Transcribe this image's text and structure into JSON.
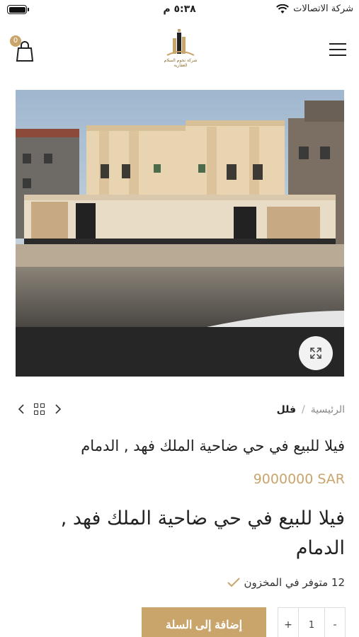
{
  "status_bar": {
    "carrier": "شركة الاتصالات",
    "time": "٥:٣٨ م",
    "icons": [
      "wifi-icon",
      "battery-icon"
    ]
  },
  "header": {
    "logo_lines": [
      "شركة نجوم السلام",
      "العقارية"
    ],
    "cart_count": "0",
    "icons": [
      "menu-icon",
      "shopping-bag-icon"
    ]
  },
  "breadcrumb": {
    "home": "الرئيسية",
    "separator": "/",
    "current": "فلل"
  },
  "product": {
    "subtitle": "فيلا للبيع في حي ضاحية الملك فهد , الدمام",
    "price": "9000000 SAR",
    "title": "فيلا للبيع في حي ضاحية الملك فهد , الدمام",
    "stock": "12 متوفر في المخزون"
  },
  "cart_controls": {
    "minus": "-",
    "quantity": "1",
    "plus": "+",
    "add_to_cart": "إضافة إلى السلة"
  },
  "colors": {
    "accent": "#c9a56c",
    "text": "#222222"
  }
}
